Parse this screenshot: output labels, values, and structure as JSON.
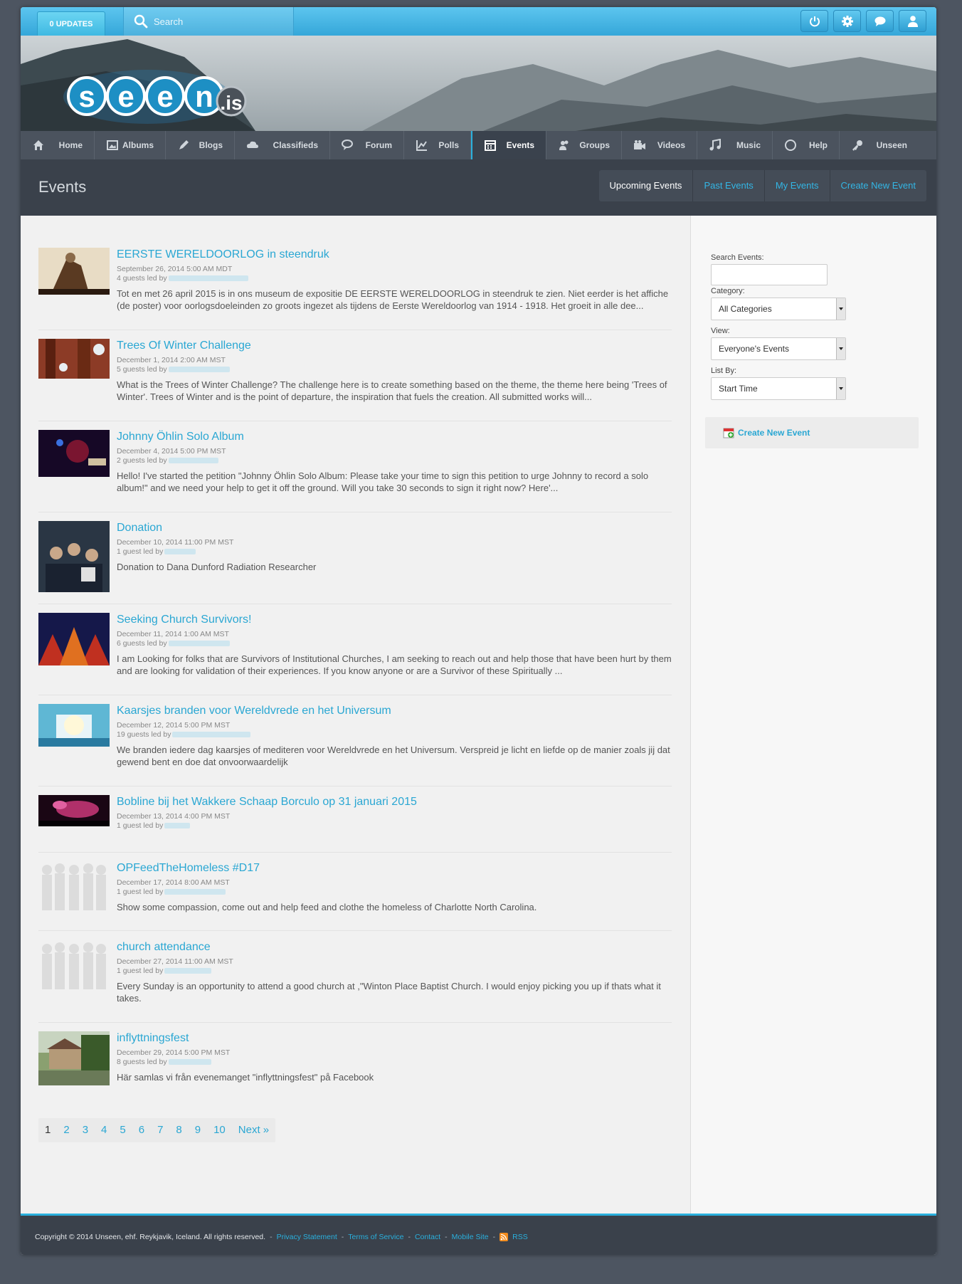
{
  "topbar": {
    "updates_label": "0 UPDATES",
    "search_placeholder": "Search"
  },
  "icons": {
    "power": "power-icon",
    "settings": "gear-icon",
    "chat": "chat-icon",
    "user": "user-icon"
  },
  "logo": {
    "text": "seen",
    "suffix": ".is"
  },
  "nav": [
    {
      "label": "Home",
      "icon": "home-icon"
    },
    {
      "label": "Albums",
      "icon": "image-icon"
    },
    {
      "label": "Blogs",
      "icon": "pen-icon"
    },
    {
      "label": "Classifieds",
      "icon": "cloud-icon"
    },
    {
      "label": "Forum",
      "icon": "chat-icon"
    },
    {
      "label": "Polls",
      "icon": "chart-icon"
    },
    {
      "label": "Events",
      "icon": "calendar-icon",
      "active": true
    },
    {
      "label": "Groups",
      "icon": "group-icon"
    },
    {
      "label": "Videos",
      "icon": "video-icon"
    },
    {
      "label": "Music",
      "icon": "music-icon"
    },
    {
      "label": "Help",
      "icon": "circle-icon"
    },
    {
      "label": "Unseen",
      "icon": "key-icon"
    }
  ],
  "page": {
    "title": "Events",
    "tabs": [
      "Upcoming Events",
      "Past Events",
      "My Events",
      "Create New Event"
    ]
  },
  "events": [
    {
      "title": "EERSTE WERELDOORLOG in steendruk",
      "date": "September 26, 2014 5:00 AM MDT",
      "guests": "4 guests led by",
      "desc": "Tot en met 26 april 2015 is in ons museum de expositie DE EERSTE WERELDOORLOG in steendruk te zien. Niet eerder is het affiche (de poster) voor oorlogsdoeleinden zo groots ingezet als tijdens de Eerste Wereldoorlog van 1914 - 1918. Het groeit in alle dee...",
      "thumb_color": "#7a5a3c"
    },
    {
      "title": "Trees Of Winter Challenge",
      "date": "December 1, 2014 2:00 AM MST",
      "guests": "5 guests led by",
      "desc": "What is the Trees of Winter Challenge? The challenge here is to create something based on the theme, the theme here being 'Trees of Winter'. Trees of Winter and is the point of departure, the inspiration that fuels the creation. All submitted works will...",
      "thumb_color": "#8c3b26"
    },
    {
      "title": "Johnny Öhlin Solo Album",
      "date": "December 4, 2014 5:00 PM MST",
      "guests": "2 guests led by",
      "desc": "Hello! I've started the petition \"Johnny Öhlin Solo Album: Please take your time to sign this petition to urge Johnny to record a solo album!\" and we need your help to get it off the ground. Will you take 30 seconds to sign it right now? Here'...",
      "thumb_color": "#2a1030"
    },
    {
      "title": "Donation",
      "date": "December 10, 2014 11:00 PM MST",
      "guests": "1 guest led by",
      "desc": "Donation to Dana Dunford Radiation Researcher",
      "thumb_color": "#34404e"
    },
    {
      "title": "Seeking Church Survivors!",
      "date": "December 11, 2014 1:00 AM MST",
      "guests": "6 guests led by",
      "desc": "I am Looking for folks that are Survivors of Institutional Churches, I am seeking to reach out and help those that have been hurt by them and are looking for validation of their experiences. If you know anyone or are a Survivor of these Spiritually ...",
      "thumb_color": "#1b1f5a"
    },
    {
      "title": "Kaarsjes branden voor Wereldvrede en het Universum",
      "date": "December 12, 2014 5:00 PM MST",
      "guests": "19 guests led by",
      "desc": "We branden iedere dag kaarsjes of mediteren voor Wereldvrede en het Universum. Verspreid je licht en liefde op de manier zoals jij dat gewend bent en doe dat onvoorwaardelijk",
      "thumb_color": "#4fa9c8"
    },
    {
      "title": "Bobline bij het Wakkere Schaap Borculo op 31 januari 2015",
      "date": "December 13, 2014 4:00 PM MST",
      "guests": "1 guest led by",
      "desc": "",
      "thumb_color": "#3a0d2a"
    },
    {
      "title": "OPFeedTheHomeless #D17",
      "date": "December 17, 2014 8:00 AM MST",
      "guests": "1 guest led by",
      "desc": "Show some compassion, come out and help feed and clothe the homeless of Charlotte North Carolina.",
      "thumb_color": "#e0e0e0"
    },
    {
      "title": "church attendance",
      "date": "December 27, 2014 11:00 AM MST",
      "guests": "1 guest led by",
      "desc": "Every Sunday is an opportunity to attend a good church at ,\"Winton Place Baptist Church. I would enjoy picking you up if thats what it takes.",
      "thumb_color": "#e0e0e0"
    },
    {
      "title": "inflyttningsfest",
      "date": "December 29, 2014 5:00 PM MST",
      "guests": "8 guests led by",
      "desc": "Här samlas vi från evenemanget \"inflyttningsfest\" på Facebook",
      "thumb_color": "#5c7048"
    }
  ],
  "pager": {
    "current": "1",
    "pages": [
      "2",
      "3",
      "4",
      "5",
      "6",
      "7",
      "8",
      "9",
      "10"
    ],
    "next": "Next »"
  },
  "sidebar": {
    "search_label": "Search Events:",
    "category_label": "Category:",
    "category_value": "All Categories",
    "view_label": "View:",
    "view_value": "Everyone's Events",
    "listby_label": "List By:",
    "listby_value": "Start Time",
    "create_label": "Create New Event"
  },
  "footer": {
    "copyright": "Copyright © 2014 Unseen, ehf. Reykjavik, Iceland. All rights reserved.",
    "links": [
      "Privacy Statement",
      "Terms of Service",
      "Contact",
      "Mobile Site",
      "RSS"
    ]
  },
  "colors": {
    "accent": "#2aa7d3",
    "topbar": "#35a7d9",
    "nav_bg": "#4b535e",
    "footer_bg": "#3a414b"
  }
}
